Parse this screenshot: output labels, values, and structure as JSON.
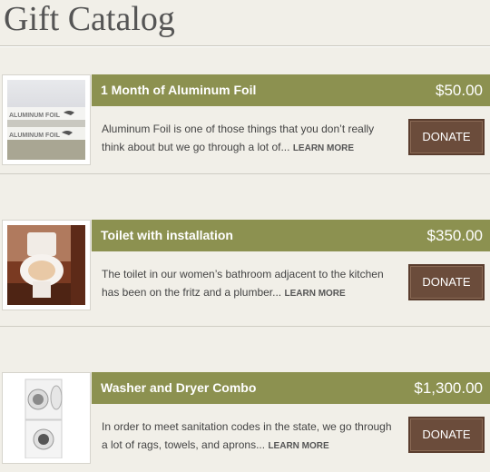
{
  "page": {
    "title": "Gift Catalog"
  },
  "gifts": [
    {
      "name": "1 Month of Aluminum Foil",
      "price": "$50.00",
      "description": "Aluminum Foil is one of those things that you don’t really think about but we go through a lot of... ",
      "learn_more": "LEARN MORE",
      "donate_label": "DONATE",
      "image_text": "ALUMINUM FOIL"
    },
    {
      "name": "Toilet with installation",
      "price": "$350.00",
      "description": "The toilet in our women’s bathroom adjacent to the kitchen has been on the fritz and a plumber... ",
      "learn_more": "LEARN MORE",
      "donate_label": "DONATE"
    },
    {
      "name": "Washer and Dryer Combo",
      "price": "$1,300.00",
      "description": "In order to meet sanitation codes in the state, we go through a lot of rags, towels, and aprons... ",
      "learn_more": "LEARN MORE",
      "donate_label": "DONATE"
    }
  ],
  "colors": {
    "header_bar": "#8c9150",
    "donate_button": "#6b4c3b",
    "background": "#f1efe8"
  }
}
